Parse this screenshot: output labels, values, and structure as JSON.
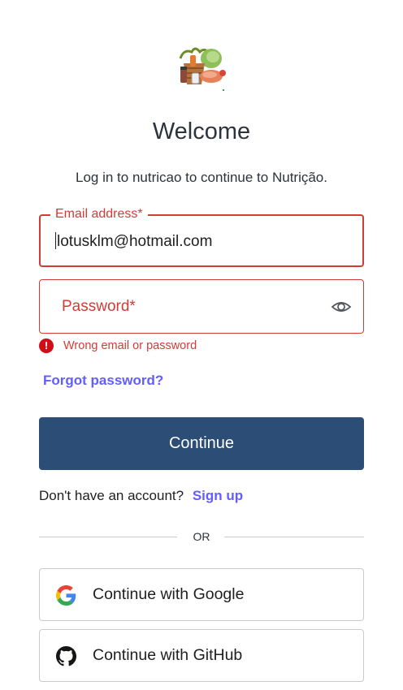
{
  "header": {
    "logo": "food-basket-logo",
    "title": "Welcome",
    "subtitle": "Log in to nutricao to continue to Nutrição."
  },
  "form": {
    "email": {
      "label": "Email address*",
      "value": "lotusklm@hotmail.com"
    },
    "password": {
      "label": "Password*",
      "toggle_icon": "eye-icon"
    },
    "error": {
      "icon": "error-icon",
      "message": "Wrong email or password"
    },
    "forgot_password": "Forgot password?",
    "continue_label": "Continue"
  },
  "signup": {
    "prompt": "Don't have an account?",
    "link": "Sign up"
  },
  "divider": {
    "label": "OR"
  },
  "social": {
    "google": {
      "icon": "google-icon",
      "label": "Continue with Google"
    },
    "github": {
      "icon": "github-icon",
      "label": "Continue with GitHub"
    }
  },
  "colors": {
    "error": "#d03c38",
    "primary_button": "#2c4d75",
    "link": "#635dff"
  }
}
